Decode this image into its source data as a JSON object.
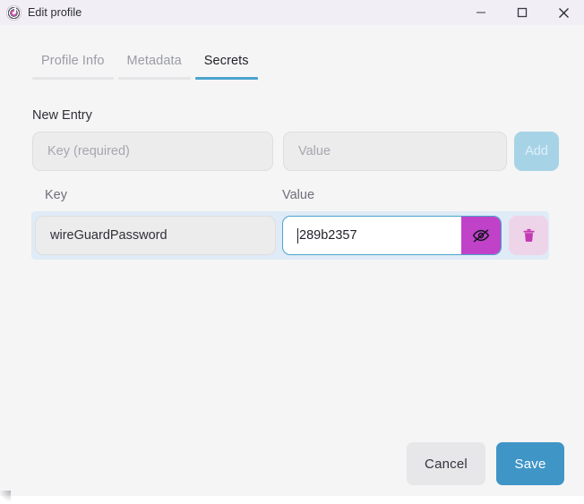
{
  "window": {
    "title": "Edit profile",
    "app_icon": "profile-logo-icon",
    "controls": {
      "minimize": "minimize-icon",
      "maximize": "maximize-icon",
      "close": "close-icon"
    },
    "titlebar_color": "#f1eef6",
    "body_color": "#f5f5f5"
  },
  "tabs": [
    {
      "label": "Profile Info",
      "active": false
    },
    {
      "label": "Metadata",
      "active": false
    },
    {
      "label": "Secrets",
      "active": true
    }
  ],
  "accent_colors": {
    "tab_active_underline": "#4ba3cd",
    "tab_inactive_underline": "#e6e6e8",
    "save_button": "#4095c7",
    "add_button_disabled": "#a7d3e7",
    "eye_button": "#bf42c8",
    "delete_button_bg": "#eed4e9",
    "delete_icon": "#c23ab4",
    "row_highlight": "#dfebf6",
    "focus_border": "#4ba3cd"
  },
  "new_entry": {
    "title": "New Entry",
    "key_placeholder": "Key (required)",
    "key_value": "",
    "value_placeholder": "Value",
    "value_value": "",
    "add_label": "Add",
    "add_disabled": true
  },
  "table": {
    "headers": {
      "key": "Key",
      "value": "Value"
    },
    "rows": [
      {
        "key": "wireGuardPassword",
        "value": "289b2357",
        "value_revealed": true,
        "value_focused": true,
        "toggle_icon": "eye-off-icon",
        "delete_icon": "trash-icon"
      }
    ]
  },
  "footer": {
    "cancel_label": "Cancel",
    "save_label": "Save"
  }
}
